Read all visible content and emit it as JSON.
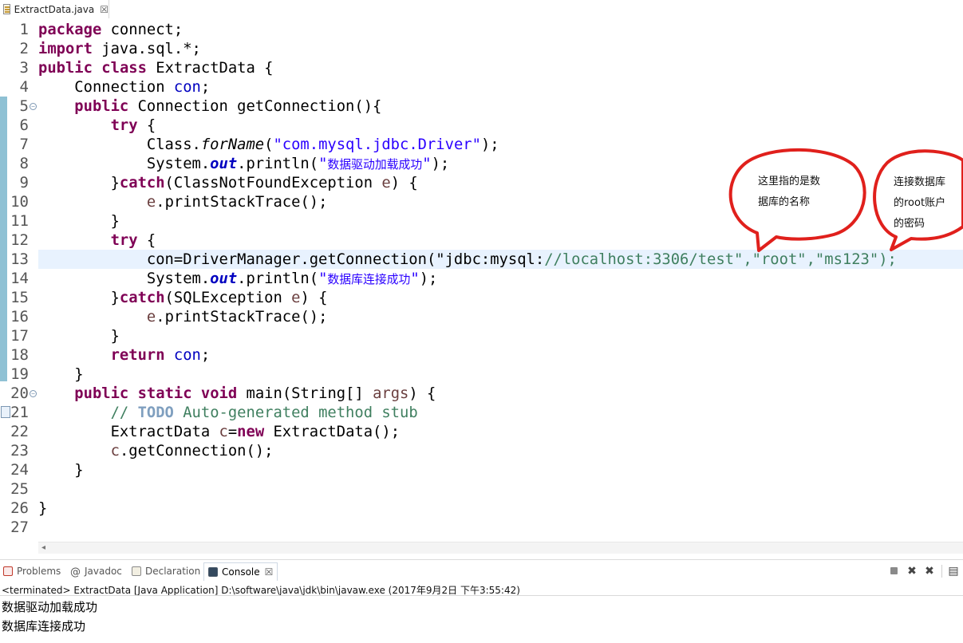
{
  "editor_tab": {
    "label": "ExtractData.java",
    "close_glyph": "☒",
    "icon": "java-file-icon"
  },
  "code": {
    "lines": [
      {
        "n": "1",
        "text": "package connect;"
      },
      {
        "n": "2",
        "text": "import java.sql.*;"
      },
      {
        "n": "3",
        "text": "public class ExtractData {"
      },
      {
        "n": "4",
        "text": "    Connection con;"
      },
      {
        "n": "5",
        "text": "    public Connection getConnection(){"
      },
      {
        "n": "6",
        "text": "        try {"
      },
      {
        "n": "7",
        "text": "            Class.forName(\"com.mysql.jdbc.Driver\");"
      },
      {
        "n": "8",
        "text": "            System.out.println(\"数据驱动加载成功\");"
      },
      {
        "n": "9",
        "text": "        }catch(ClassNotFoundException e) {"
      },
      {
        "n": "10",
        "text": "            e.printStackTrace();"
      },
      {
        "n": "11",
        "text": "        }"
      },
      {
        "n": "12",
        "text": "        try {"
      },
      {
        "n": "13",
        "text": "            con=DriverManager.getConnection(\"jdbc:mysql://localhost:3306/test\",\"root\",\"ms123\");"
      },
      {
        "n": "14",
        "text": "            System.out.println(\"数据库连接成功\");"
      },
      {
        "n": "15",
        "text": "        }catch(SQLException e) {"
      },
      {
        "n": "16",
        "text": "            e.printStackTrace();"
      },
      {
        "n": "17",
        "text": "        }"
      },
      {
        "n": "18",
        "text": "        return con;"
      },
      {
        "n": "19",
        "text": "    }"
      },
      {
        "n": "20",
        "text": "    public static void main(String[] args) {"
      },
      {
        "n": "21",
        "text": "        // TODO Auto-generated method stub"
      },
      {
        "n": "22",
        "text": "        ExtractData c=new ExtractData();"
      },
      {
        "n": "23",
        "text": "        c.getConnection();"
      },
      {
        "n": "24",
        "text": "    }"
      },
      {
        "n": "25",
        "text": ""
      },
      {
        "n": "26",
        "text": "}"
      },
      {
        "n": "27",
        "text": ""
      }
    ]
  },
  "annotations": {
    "db_name_note": {
      "line1": "这里指的是数",
      "line2": "据库的名称"
    },
    "password_note": {
      "line1": "连接数据库",
      "line2": "的root账户",
      "line3": "的密码"
    }
  },
  "colors": {
    "keyword": "#7f0055",
    "string": "#2a00ff",
    "field": "#0000c0",
    "comment": "#3f7f5f",
    "annotation_circle": "#e0201c",
    "current_line": "#e8f2fe"
  },
  "views": {
    "tabs": [
      {
        "label": "Problems",
        "icon": "problems-icon"
      },
      {
        "label": "Javadoc",
        "icon": "javadoc-icon"
      },
      {
        "label": "Declaration",
        "icon": "declaration-icon"
      },
      {
        "label": "Console",
        "icon": "console-icon",
        "active": true
      }
    ],
    "close_glyph": "☒"
  },
  "console": {
    "status": "<terminated> ExtractData [Java Application] D:\\software\\java\\jdk\\bin\\javaw.exe (2017年9月2日 下午3:55:42)",
    "output": [
      "数据驱动加载成功",
      "数据库连接成功"
    ]
  }
}
